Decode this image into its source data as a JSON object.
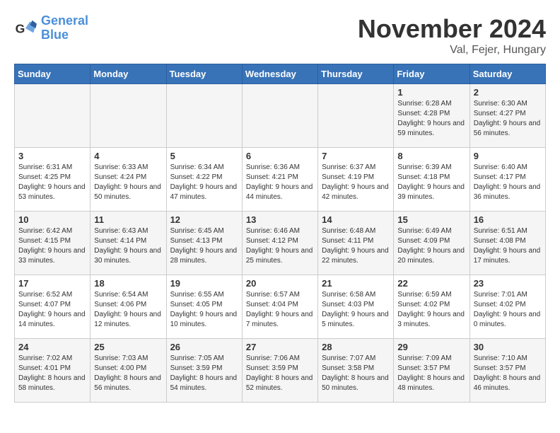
{
  "logo": {
    "line1": "General",
    "line2": "Blue"
  },
  "title": "November 2024",
  "location": "Val, Fejer, Hungary",
  "weekdays": [
    "Sunday",
    "Monday",
    "Tuesday",
    "Wednesday",
    "Thursday",
    "Friday",
    "Saturday"
  ],
  "weeks": [
    [
      {
        "day": "",
        "info": ""
      },
      {
        "day": "",
        "info": ""
      },
      {
        "day": "",
        "info": ""
      },
      {
        "day": "",
        "info": ""
      },
      {
        "day": "",
        "info": ""
      },
      {
        "day": "1",
        "info": "Sunrise: 6:28 AM\nSunset: 4:28 PM\nDaylight: 9 hours and 59 minutes."
      },
      {
        "day": "2",
        "info": "Sunrise: 6:30 AM\nSunset: 4:27 PM\nDaylight: 9 hours and 56 minutes."
      }
    ],
    [
      {
        "day": "3",
        "info": "Sunrise: 6:31 AM\nSunset: 4:25 PM\nDaylight: 9 hours and 53 minutes."
      },
      {
        "day": "4",
        "info": "Sunrise: 6:33 AM\nSunset: 4:24 PM\nDaylight: 9 hours and 50 minutes."
      },
      {
        "day": "5",
        "info": "Sunrise: 6:34 AM\nSunset: 4:22 PM\nDaylight: 9 hours and 47 minutes."
      },
      {
        "day": "6",
        "info": "Sunrise: 6:36 AM\nSunset: 4:21 PM\nDaylight: 9 hours and 44 minutes."
      },
      {
        "day": "7",
        "info": "Sunrise: 6:37 AM\nSunset: 4:19 PM\nDaylight: 9 hours and 42 minutes."
      },
      {
        "day": "8",
        "info": "Sunrise: 6:39 AM\nSunset: 4:18 PM\nDaylight: 9 hours and 39 minutes."
      },
      {
        "day": "9",
        "info": "Sunrise: 6:40 AM\nSunset: 4:17 PM\nDaylight: 9 hours and 36 minutes."
      }
    ],
    [
      {
        "day": "10",
        "info": "Sunrise: 6:42 AM\nSunset: 4:15 PM\nDaylight: 9 hours and 33 minutes."
      },
      {
        "day": "11",
        "info": "Sunrise: 6:43 AM\nSunset: 4:14 PM\nDaylight: 9 hours and 30 minutes."
      },
      {
        "day": "12",
        "info": "Sunrise: 6:45 AM\nSunset: 4:13 PM\nDaylight: 9 hours and 28 minutes."
      },
      {
        "day": "13",
        "info": "Sunrise: 6:46 AM\nSunset: 4:12 PM\nDaylight: 9 hours and 25 minutes."
      },
      {
        "day": "14",
        "info": "Sunrise: 6:48 AM\nSunset: 4:11 PM\nDaylight: 9 hours and 22 minutes."
      },
      {
        "day": "15",
        "info": "Sunrise: 6:49 AM\nSunset: 4:09 PM\nDaylight: 9 hours and 20 minutes."
      },
      {
        "day": "16",
        "info": "Sunrise: 6:51 AM\nSunset: 4:08 PM\nDaylight: 9 hours and 17 minutes."
      }
    ],
    [
      {
        "day": "17",
        "info": "Sunrise: 6:52 AM\nSunset: 4:07 PM\nDaylight: 9 hours and 14 minutes."
      },
      {
        "day": "18",
        "info": "Sunrise: 6:54 AM\nSunset: 4:06 PM\nDaylight: 9 hours and 12 minutes."
      },
      {
        "day": "19",
        "info": "Sunrise: 6:55 AM\nSunset: 4:05 PM\nDaylight: 9 hours and 10 minutes."
      },
      {
        "day": "20",
        "info": "Sunrise: 6:57 AM\nSunset: 4:04 PM\nDaylight: 9 hours and 7 minutes."
      },
      {
        "day": "21",
        "info": "Sunrise: 6:58 AM\nSunset: 4:03 PM\nDaylight: 9 hours and 5 minutes."
      },
      {
        "day": "22",
        "info": "Sunrise: 6:59 AM\nSunset: 4:02 PM\nDaylight: 9 hours and 3 minutes."
      },
      {
        "day": "23",
        "info": "Sunrise: 7:01 AM\nSunset: 4:02 PM\nDaylight: 9 hours and 0 minutes."
      }
    ],
    [
      {
        "day": "24",
        "info": "Sunrise: 7:02 AM\nSunset: 4:01 PM\nDaylight: 8 hours and 58 minutes."
      },
      {
        "day": "25",
        "info": "Sunrise: 7:03 AM\nSunset: 4:00 PM\nDaylight: 8 hours and 56 minutes."
      },
      {
        "day": "26",
        "info": "Sunrise: 7:05 AM\nSunset: 3:59 PM\nDaylight: 8 hours and 54 minutes."
      },
      {
        "day": "27",
        "info": "Sunrise: 7:06 AM\nSunset: 3:59 PM\nDaylight: 8 hours and 52 minutes."
      },
      {
        "day": "28",
        "info": "Sunrise: 7:07 AM\nSunset: 3:58 PM\nDaylight: 8 hours and 50 minutes."
      },
      {
        "day": "29",
        "info": "Sunrise: 7:09 AM\nSunset: 3:57 PM\nDaylight: 8 hours and 48 minutes."
      },
      {
        "day": "30",
        "info": "Sunrise: 7:10 AM\nSunset: 3:57 PM\nDaylight: 8 hours and 46 minutes."
      }
    ]
  ]
}
